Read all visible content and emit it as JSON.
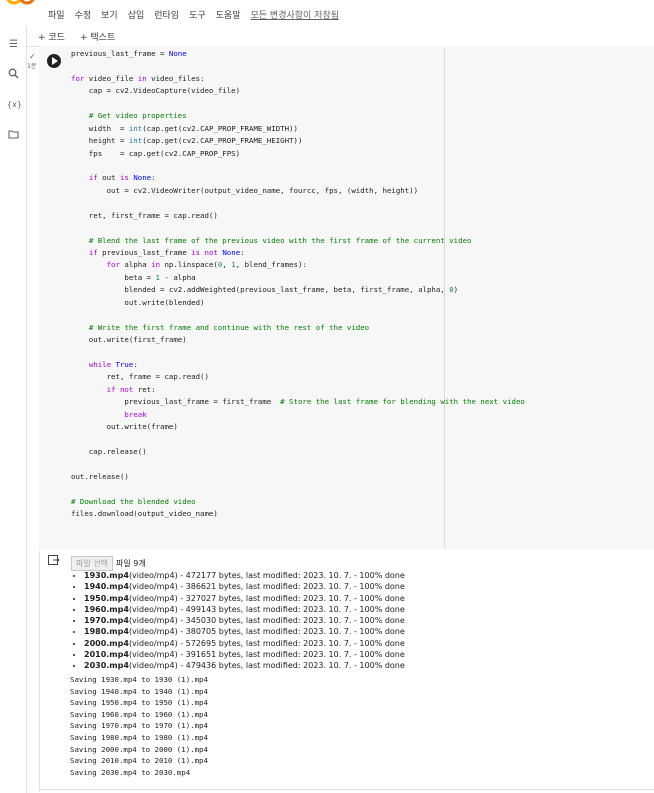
{
  "menubar": {
    "items": [
      "파일",
      "수정",
      "보기",
      "삽입",
      "런타임",
      "도구",
      "도움말"
    ],
    "saved_status": "모든 변경사항이 저장됨"
  },
  "toolbar": {
    "add_code": "+ 코드",
    "add_text": "+ 텍스트"
  },
  "cell": {
    "exec_time": "1분"
  },
  "code_lines": [
    "previous_last_frame = None",
    "",
    "for video_file in video_files:",
    "    cap = cv2.VideoCapture(video_file)",
    "",
    "    # Get video properties",
    "    width  = int(cap.get(cv2.CAP_PROP_FRAME_WIDTH))",
    "    height = int(cap.get(cv2.CAP_PROP_FRAME_HEIGHT))",
    "    fps    = cap.get(cv2.CAP_PROP_FPS)",
    "",
    "    if out is None:",
    "        out = cv2.VideoWriter(output_video_name, fourcc, fps, (width, height))",
    "",
    "    ret, first_frame = cap.read()",
    "",
    "    # Blend the last frame of the previous video with the first frame of the current video",
    "    if previous_last_frame is not None:",
    "        for alpha in np.linspace(0, 1, blend_frames):",
    "            beta = 1 - alpha",
    "            blended = cv2.addWeighted(previous_last_frame, beta, first_frame, alpha, 0)",
    "            out.write(blended)",
    "",
    "    # Write the first frame and continue with the rest of the video",
    "    out.write(first_frame)",
    "",
    "    while True:",
    "        ret, frame = cap.read()",
    "        if not ret:",
    "            previous_last_frame = first_frame  # Store the last frame for blending with the next video",
    "            break",
    "        out.write(frame)",
    "",
    "    cap.release()",
    "",
    "out.release()",
    "",
    "# Download the blended video",
    "files.download(output_video_name)"
  ],
  "output": {
    "file_button": "파일 선택",
    "file_count": "파일 9개",
    "files": [
      {
        "name": "1930.mp4",
        "detail": "(video/mp4) - 472177 bytes, last modified: 2023. 10. 7. - 100% done"
      },
      {
        "name": "1940.mp4",
        "detail": "(video/mp4) - 386621 bytes, last modified: 2023. 10. 7. - 100% done"
      },
      {
        "name": "1950.mp4",
        "detail": "(video/mp4) - 327027 bytes, last modified: 2023. 10. 7. - 100% done"
      },
      {
        "name": "1960.mp4",
        "detail": "(video/mp4) - 499143 bytes, last modified: 2023. 10. 7. - 100% done"
      },
      {
        "name": "1970.mp4",
        "detail": "(video/mp4) - 345030 bytes, last modified: 2023. 10. 7. - 100% done"
      },
      {
        "name": "1980.mp4",
        "detail": "(video/mp4) - 380705 bytes, last modified: 2023. 10. 7. - 100% done"
      },
      {
        "name": "2000.mp4",
        "detail": "(video/mp4) - 572695 bytes, last modified: 2023. 10. 7. - 100% done"
      },
      {
        "name": "2010.mp4",
        "detail": "(video/mp4) - 391651 bytes, last modified: 2023. 10. 7. - 100% done"
      },
      {
        "name": "2030.mp4",
        "detail": "(video/mp4) - 479436 bytes, last modified: 2023. 10. 7. - 100% done"
      }
    ],
    "saving_lines": [
      "Saving 1930.mp4 to 1930 (1).mp4",
      "Saving 1940.mp4 to 1940 (1).mp4",
      "Saving 1950.mp4 to 1950 (1).mp4",
      "Saving 1960.mp4 to 1960 (1).mp4",
      "Saving 1970.mp4 to 1970 (1).mp4",
      "Saving 1980.mp4 to 1980 (1).mp4",
      "Saving 2000.mp4 to 2000 (1).mp4",
      "Saving 2010.mp4 to 2010 (1).mp4",
      "Saving 2030.mp4 to 2030.mp4"
    ]
  },
  "icons": {
    "sidebar": [
      "menu-icon",
      "search-icon",
      "variables-icon",
      "folder-icon"
    ],
    "run": "play-icon",
    "output": "output-icon"
  },
  "colors": {
    "logo_orange": "#f9ab00",
    "run_button": "#202124"
  }
}
